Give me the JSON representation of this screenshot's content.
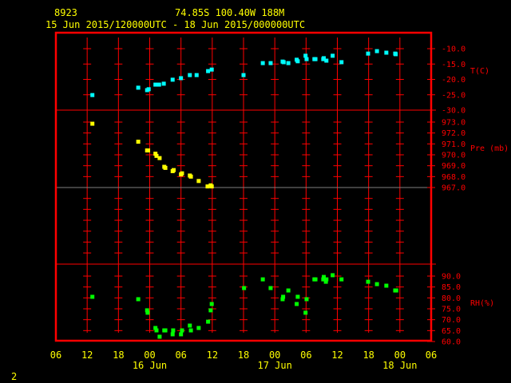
{
  "header": {
    "station": "8923",
    "location": "74.85S  100.40W   188M",
    "time_range": "15 Jun 2015/120000UTC - 18 Jun 2015/000000UTC"
  },
  "footer": {
    "page": "2"
  },
  "colors": {
    "frame": "#ff0000",
    "temperature": "#00ffff",
    "pressure": "#ffff00",
    "humidity": "#00ff00",
    "text": "#ffff00",
    "reference_line": "#808080"
  },
  "chart_data": [
    {
      "type": "scatter",
      "title": "Temperature",
      "ylabel": "T(C)",
      "x_unit": "hours since 15 Jun 2015 06 UTC",
      "xlim": [
        0,
        72
      ],
      "ylim": [
        -30,
        -4.8
      ],
      "yticks": [
        "-10.0",
        "-15.0",
        "-20.0",
        "-25.0",
        "-30.0"
      ],
      "ytick_values": [
        -10,
        -15,
        -20,
        -25,
        -30
      ],
      "points": [
        [
          7.0,
          -25.1
        ],
        [
          15.8,
          -22.7
        ],
        [
          17.5,
          -23.5
        ],
        [
          17.8,
          -23.2
        ],
        [
          19.1,
          -21.7
        ],
        [
          19.8,
          -21.7
        ],
        [
          20.7,
          -21.4
        ],
        [
          22.4,
          -20.1
        ],
        [
          24.0,
          -19.6
        ],
        [
          25.7,
          -18.6
        ],
        [
          27.0,
          -18.6
        ],
        [
          29.2,
          -17.3
        ],
        [
          29.9,
          -16.8
        ],
        [
          36.0,
          -18.6
        ],
        [
          39.7,
          -14.7
        ],
        [
          41.2,
          -14.7
        ],
        [
          43.5,
          -14.2
        ],
        [
          43.7,
          -14.4
        ],
        [
          44.6,
          -14.7
        ],
        [
          46.2,
          -13.6
        ],
        [
          46.4,
          -14.1
        ],
        [
          47.9,
          -12.3
        ],
        [
          48.1,
          -13.4
        ],
        [
          49.6,
          -13.4
        ],
        [
          49.8,
          -13.4
        ],
        [
          51.3,
          -13.4
        ],
        [
          51.4,
          -13.1
        ],
        [
          51.9,
          -13.9
        ],
        [
          53.1,
          -12.3
        ],
        [
          54.8,
          -14.4
        ],
        [
          59.9,
          -11.6
        ],
        [
          61.6,
          -10.8
        ],
        [
          63.4,
          -11.3
        ],
        [
          65.1,
          -11.6
        ],
        [
          65.2,
          -11.8
        ]
      ]
    },
    {
      "type": "scatter",
      "title": "Pressure",
      "ylabel": "Pre (mb)",
      "x_unit": "hours since 15 Jun 2015 06 UTC",
      "xlim": [
        0,
        72
      ],
      "yticks": [
        "973.0",
        "972.0",
        "971.0",
        "970.0",
        "969.0",
        "968.0",
        "967.0"
      ],
      "ytick_values": [
        973,
        972,
        971,
        970,
        969,
        968,
        967
      ],
      "reference_line": 967,
      "points": [
        [
          7.0,
          972.85
        ],
        [
          15.8,
          971.2
        ],
        [
          17.5,
          970.4
        ],
        [
          17.7,
          970.4
        ],
        [
          19.1,
          970.1
        ],
        [
          19.3,
          969.9
        ],
        [
          19.9,
          969.7
        ],
        [
          20.8,
          968.9
        ],
        [
          21.0,
          968.8
        ],
        [
          22.4,
          968.5
        ],
        [
          22.6,
          968.6
        ],
        [
          24.0,
          968.2
        ],
        [
          24.2,
          968.3
        ],
        [
          25.7,
          968.1
        ],
        [
          25.9,
          968.0
        ],
        [
          27.4,
          967.6
        ],
        [
          29.1,
          967.1
        ],
        [
          29.7,
          967.2
        ],
        [
          29.9,
          967.1
        ]
      ]
    },
    {
      "type": "scatter",
      "title": "Relative Humidity",
      "ylabel": "RH(%)",
      "x_unit": "hours since 15 Jun 2015 06 UTC",
      "xlim": [
        0,
        72
      ],
      "yticks": [
        "90.0",
        "85.0",
        "80.0",
        "75.0",
        "70.0",
        "65.0",
        "60.0"
      ],
      "ytick_values": [
        90,
        85,
        80,
        75,
        70,
        65,
        60
      ],
      "points": [
        [
          7.0,
          80.5
        ],
        [
          15.8,
          79.4
        ],
        [
          17.5,
          74.3
        ],
        [
          17.6,
          73.2
        ],
        [
          19.1,
          66.2
        ],
        [
          19.3,
          65.1
        ],
        [
          19.9,
          62.2
        ],
        [
          20.8,
          65.1
        ],
        [
          21.0,
          65.1
        ],
        [
          22.4,
          63.3
        ],
        [
          22.5,
          65.1
        ],
        [
          24.0,
          63.3
        ],
        [
          24.2,
          65.1
        ],
        [
          25.7,
          67.3
        ],
        [
          25.9,
          65.1
        ],
        [
          27.4,
          66.2
        ],
        [
          29.2,
          69.1
        ],
        [
          29.7,
          74.3
        ],
        [
          29.9,
          77.2
        ],
        [
          36.1,
          84.5
        ],
        [
          39.7,
          88.5
        ],
        [
          41.2,
          84.5
        ],
        [
          43.6,
          80.5
        ],
        [
          43.5,
          79.4
        ],
        [
          44.6,
          83.4
        ],
        [
          46.4,
          80.5
        ],
        [
          46.2,
          77.2
        ],
        [
          48.1,
          79.4
        ],
        [
          47.9,
          73.2
        ],
        [
          49.6,
          88.5
        ],
        [
          49.8,
          88.5
        ],
        [
          51.3,
          88.5
        ],
        [
          51.4,
          89.6
        ],
        [
          51.8,
          87.4
        ],
        [
          51.9,
          88.5
        ],
        [
          53.1,
          90.4
        ],
        [
          54.8,
          88.5
        ],
        [
          59.9,
          87.4
        ],
        [
          61.6,
          86.3
        ],
        [
          63.4,
          85.6
        ],
        [
          65.1,
          83.4
        ],
        [
          65.3,
          83.4
        ]
      ]
    }
  ],
  "x_axis": {
    "tick_labels": [
      "06",
      "12",
      "18",
      "00",
      "06",
      "12",
      "18",
      "00",
      "06",
      "12",
      "18",
      "00",
      "06"
    ],
    "date_labels": [
      {
        "label": "16 Jun",
        "hour": 18
      },
      {
        "label": "17 Jun",
        "hour": 42
      },
      {
        "label": "18 Jun",
        "hour": 66
      }
    ]
  }
}
